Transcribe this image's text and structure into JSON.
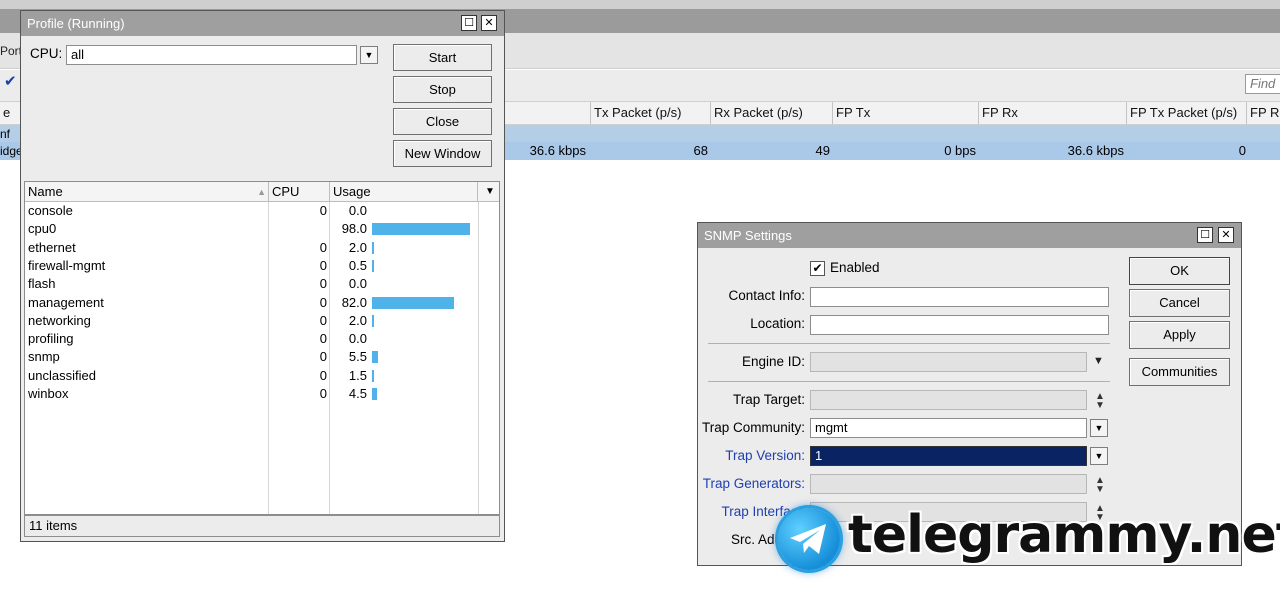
{
  "background": {
    "menu_label": "Ports",
    "find_placeholder": "Find",
    "columns": [
      "e",
      "Tx Packet (p/s)",
      "Rx Packet (p/s)",
      "FP Tx",
      "FP Rx",
      "FP Tx Packet (p/s)",
      "FP R"
    ],
    "rows": [
      {
        "name": "nf",
        "cells": []
      },
      {
        "name": "idge",
        "cells": [
          "36.6 kbps",
          "68",
          "49",
          "0 bps",
          "36.6 kbps",
          "0"
        ]
      }
    ]
  },
  "profile": {
    "title": "Profile (Running)",
    "cpu_label": "CPU:",
    "cpu_value": "all",
    "buttons": {
      "start": "Start",
      "stop": "Stop",
      "close": "Close",
      "new_window": "New Window"
    },
    "columns": {
      "name": "Name",
      "cpu": "CPU",
      "usage": "Usage"
    },
    "rows": [
      {
        "name": "console",
        "cpu": "0",
        "usage": "0.0",
        "usage_pct": 0.0
      },
      {
        "name": "cpu0",
        "cpu": "",
        "usage": "98.0",
        "usage_pct": 98.0
      },
      {
        "name": "ethernet",
        "cpu": "0",
        "usage": "2.0",
        "usage_pct": 2.0
      },
      {
        "name": "firewall-mgmt",
        "cpu": "0",
        "usage": "0.5",
        "usage_pct": 0.5
      },
      {
        "name": "flash",
        "cpu": "0",
        "usage": "0.0",
        "usage_pct": 0.0
      },
      {
        "name": "management",
        "cpu": "0",
        "usage": "82.0",
        "usage_pct": 82.0
      },
      {
        "name": "networking",
        "cpu": "0",
        "usage": "2.0",
        "usage_pct": 2.0
      },
      {
        "name": "profiling",
        "cpu": "0",
        "usage": "0.0",
        "usage_pct": 0.0
      },
      {
        "name": "snmp",
        "cpu": "0",
        "usage": "5.5",
        "usage_pct": 5.5
      },
      {
        "name": "unclassified",
        "cpu": "0",
        "usage": "1.5",
        "usage_pct": 1.5
      },
      {
        "name": "winbox",
        "cpu": "0",
        "usage": "4.5",
        "usage_pct": 4.5
      }
    ],
    "status": "11 items"
  },
  "snmp": {
    "title": "SNMP Settings",
    "enabled_label": "Enabled",
    "enabled": true,
    "contact_info_label": "Contact Info:",
    "contact_info": "",
    "location_label": "Location:",
    "location": "",
    "engine_id_label": "Engine ID:",
    "trap_target_label": "Trap Target:",
    "trap_community_label": "Trap Community:",
    "trap_community": "mgmt",
    "trap_version_label": "Trap Version:",
    "trap_version": "1",
    "trap_generators_label": "Trap Generators:",
    "trap_interfaces_label": "Trap Interface",
    "src_address_label": "Src. Add",
    "buttons": {
      "ok": "OK",
      "cancel": "Cancel",
      "apply": "Apply",
      "communities": "Communities"
    }
  },
  "watermark": {
    "text": "telegrammy.net"
  },
  "colors": {
    "selection": "#aac8e8",
    "bar": "#4fb3ea",
    "title_bar": "#9f9f9f",
    "highlight_field": "#0a2463",
    "blue_label": "#1f3fb0"
  }
}
